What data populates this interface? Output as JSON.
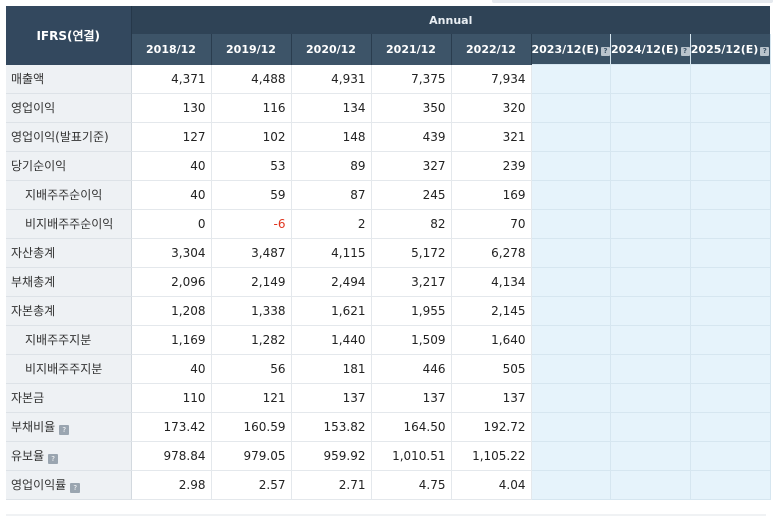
{
  "header": {
    "label_header": "IFRS(연결)",
    "group_title": "Annual",
    "years": [
      "2018/12",
      "2019/12",
      "2020/12",
      "2021/12",
      "2022/12"
    ],
    "estimate_years": [
      "2023/12(E)",
      "2024/12(E)",
      "2025/12(E)"
    ],
    "info_icon": "info-icon"
  },
  "rows": [
    {
      "label": "매출액",
      "values": [
        "4,371",
        "4,488",
        "4,931",
        "7,375",
        "7,934"
      ]
    },
    {
      "label": "영업이익",
      "values": [
        "130",
        "116",
        "134",
        "350",
        "320"
      ]
    },
    {
      "label": "영업이익(발표기준)",
      "values": [
        "127",
        "102",
        "148",
        "439",
        "321"
      ]
    },
    {
      "label": "당기순이익",
      "values": [
        "40",
        "53",
        "89",
        "327",
        "239"
      ]
    },
    {
      "label": "지배주주순이익",
      "values": [
        "40",
        "59",
        "87",
        "245",
        "169"
      ]
    },
    {
      "label": "비지배주주순이익",
      "values": [
        "0",
        "-6",
        "2",
        "82",
        "70"
      ]
    },
    {
      "label": "자산총계",
      "values": [
        "3,304",
        "3,487",
        "4,115",
        "5,172",
        "6,278"
      ]
    },
    {
      "label": "부채총계",
      "values": [
        "2,096",
        "2,149",
        "2,494",
        "3,217",
        "4,134"
      ]
    },
    {
      "label": "자본총계",
      "values": [
        "1,208",
        "1,338",
        "1,621",
        "1,955",
        "2,145"
      ]
    },
    {
      "label": "지배주주지분",
      "values": [
        "1,169",
        "1,282",
        "1,440",
        "1,509",
        "1,640"
      ]
    },
    {
      "label": "비지배주주지분",
      "values": [
        "40",
        "56",
        "181",
        "446",
        "505"
      ]
    },
    {
      "label": "자본금",
      "values": [
        "110",
        "121",
        "137",
        "137",
        "137"
      ]
    },
    {
      "label": "부채비율",
      "values": [
        "173.42",
        "160.59",
        "153.82",
        "164.50",
        "192.72"
      ]
    },
    {
      "label": "유보율",
      "values": [
        "978.84",
        "979.05",
        "959.92",
        "1,010.51",
        "1,105.22"
      ]
    },
    {
      "label": "영업이익률",
      "values": [
        "2.98",
        "2.57",
        "2.71",
        "4.75",
        "4.04"
      ]
    }
  ],
  "colors": {
    "header_bg": "#33485e",
    "estimate_bg": "#e6f3fb",
    "negative": "#e0341e",
    "label_bg": "#eef1f4"
  }
}
